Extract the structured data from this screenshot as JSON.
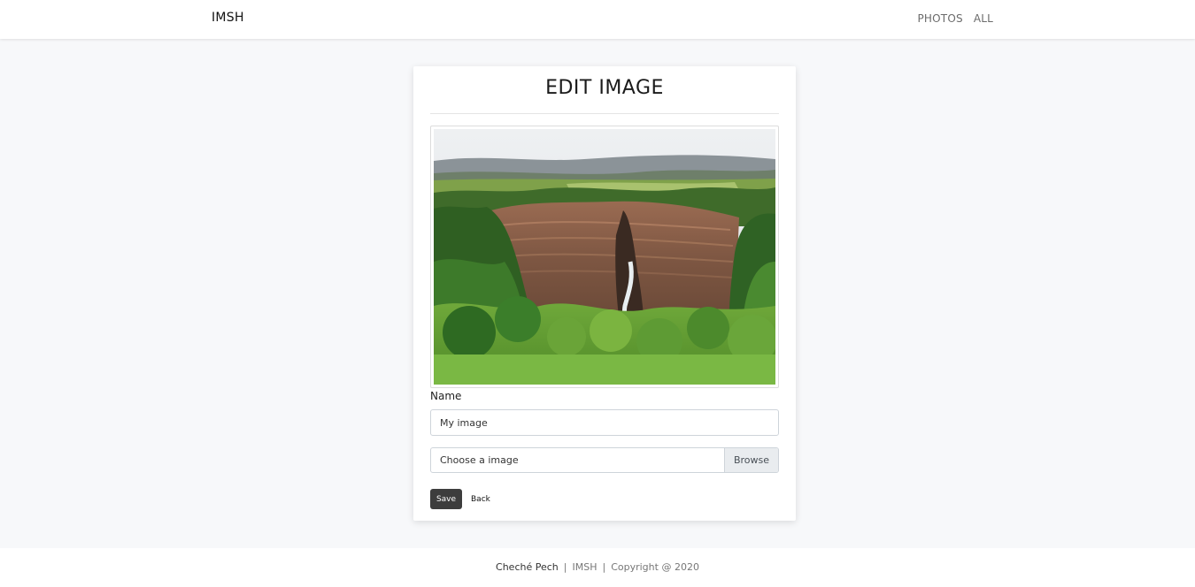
{
  "navbar": {
    "brand": "IMSH",
    "links": [
      "PHOTOS",
      "ALL"
    ]
  },
  "card": {
    "title": "EDIT IMAGE",
    "image_alt": "canyon landscape photo"
  },
  "form": {
    "name_label": "Name",
    "name_value": "My image",
    "file_label": "Choose a image",
    "browse_label": "Browse",
    "save_label": "Save",
    "back_label": "Back"
  },
  "footer": {
    "author": "Cheché Pech",
    "brand": "IMSH",
    "copyright": "Copyright @ 2020",
    "separator": "|"
  },
  "colors": {
    "page_bg": "#f7f8fa",
    "card_bg": "#ffffff",
    "save_button": "#3d3d3d",
    "browse_bg": "#e9ecef"
  }
}
